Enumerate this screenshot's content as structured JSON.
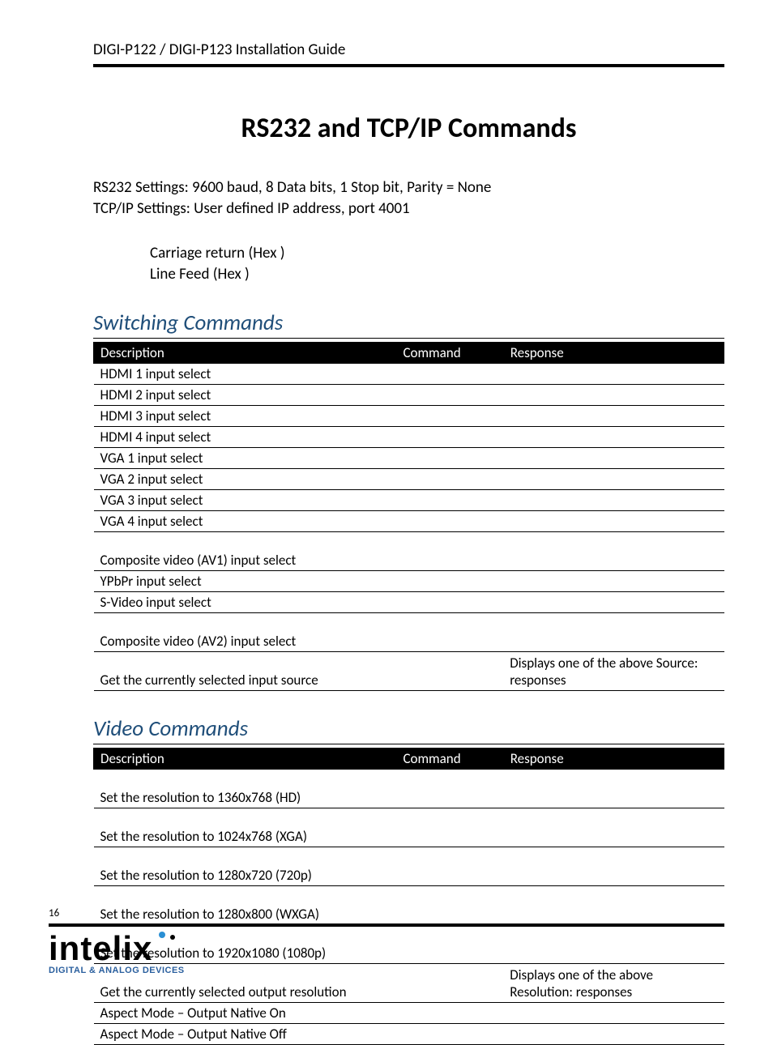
{
  "header": "DIGI-P122 / DIGI-P123 Installation Guide",
  "title": "RS232 and TCP/IP Commands",
  "settings_line1": "RS232 Settings: 9600 baud, 8 Data bits, 1 Stop bit, Parity = None",
  "settings_line2": "TCP/IP Settings: User defined IP address, port 4001",
  "cr_line": "Carriage return (Hex      )",
  "lf_line": "Line Feed (Hex      )",
  "section1_title": "Switching Commands",
  "section2_title": "Video Commands",
  "table_headers": {
    "c1": "Description",
    "c2": "Command",
    "c3": "Response"
  },
  "switching_rows": [
    {
      "desc": "HDMI 1 input select",
      "cmd": "",
      "resp": "",
      "tall": false
    },
    {
      "desc": "HDMI 2 input select",
      "cmd": "",
      "resp": "",
      "tall": false
    },
    {
      "desc": "HDMI 3 input select",
      "cmd": "",
      "resp": "",
      "tall": false
    },
    {
      "desc": "HDMI 4 input select",
      "cmd": "",
      "resp": "",
      "tall": false
    },
    {
      "desc": "VGA 1 input select",
      "cmd": "",
      "resp": "",
      "tall": false
    },
    {
      "desc": "VGA 2 input select",
      "cmd": "",
      "resp": "",
      "tall": false
    },
    {
      "desc": "VGA 3 input select",
      "cmd": "",
      "resp": "",
      "tall": false
    },
    {
      "desc": "VGA 4 input select",
      "cmd": "",
      "resp": "",
      "tall": false
    },
    {
      "desc": "Composite video (AV1) input select",
      "cmd": "",
      "resp": "",
      "tall": true
    },
    {
      "desc": "YPbPr input select",
      "cmd": "",
      "resp": "",
      "tall": false
    },
    {
      "desc": "S-Video input select",
      "cmd": "",
      "resp": "",
      "tall": false
    },
    {
      "desc": "Composite video (AV2) input select",
      "cmd": "",
      "resp": "",
      "tall": true
    },
    {
      "desc": "Get the currently selected input source",
      "cmd": "",
      "resp": "Displays one of the above Source: responses",
      "tall": true
    }
  ],
  "video_rows": [
    {
      "desc": "Set the resolution to 1360x768 (HD)",
      "cmd": "",
      "resp": "",
      "tall": true
    },
    {
      "desc": "Set the resolution to 1024x768 (XGA)",
      "cmd": "",
      "resp": "",
      "tall": true
    },
    {
      "desc": "Set the resolution to 1280x720 (720p)",
      "cmd": "",
      "resp": "",
      "tall": true
    },
    {
      "desc": "Set the resolution to 1280x800 (WXGA)",
      "cmd": "",
      "resp": "",
      "tall": true
    },
    {
      "desc": "Set the resolution to 1920x1080 (1080p)",
      "cmd": "",
      "resp": "",
      "tall": true
    },
    {
      "desc": "Get the currently selected output resolution",
      "cmd": "",
      "resp": "Displays one of the above Resolution: responses",
      "tall": true
    },
    {
      "desc": "Aspect Mode – Output Native On",
      "cmd": "",
      "resp": "",
      "tall": false
    },
    {
      "desc": "Aspect Mode – Output Native Off",
      "cmd": "",
      "resp": "",
      "tall": false
    }
  ],
  "page_number": "16",
  "logo_text": "intelix",
  "logo_sub": "DIGITAL & ANALOG DEVICES"
}
